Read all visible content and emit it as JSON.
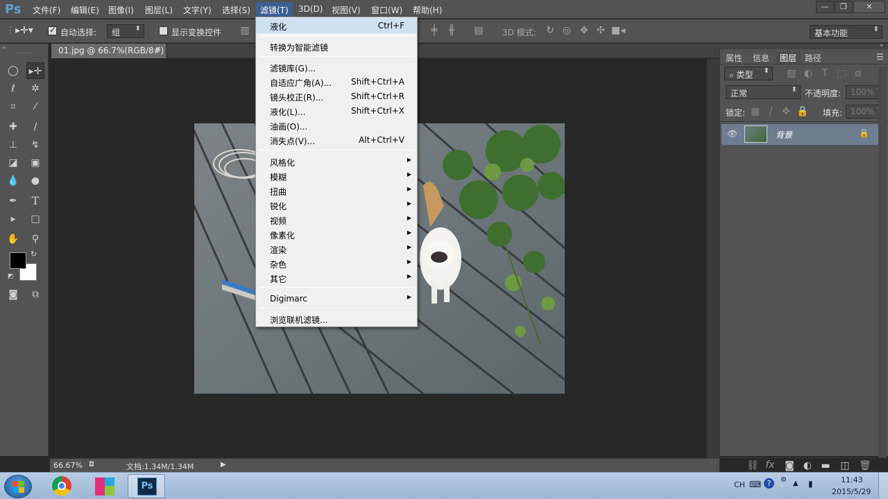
{
  "app": {
    "logo": "Ps"
  },
  "menubar": {
    "items": [
      "文件(F)",
      "编辑(E)",
      "图像(I)",
      "图层(L)",
      "文字(Y)",
      "选择(S)",
      "滤镜(T)",
      "3D(D)",
      "视图(V)",
      "窗口(W)",
      "帮助(H)"
    ],
    "window_controls": {
      "minimize": "—",
      "restore": "❐",
      "close": "✕"
    }
  },
  "options": {
    "auto_select_label": "自动选择:",
    "auto_select_value": "组",
    "show_transform_label": "显示变换控件",
    "mode3d_label": "3D 模式:",
    "workspace": "基本功能"
  },
  "document_tab": {
    "title": "01.jpg @ 66.7%(RGB/8#)",
    "close": "✕"
  },
  "panels": {
    "tabs": [
      "属性",
      "信息",
      "图层",
      "路径"
    ],
    "filter_kind": "类型",
    "blend_mode": "正常",
    "opacity_label": "不透明度:",
    "opacity_value": "100%",
    "lock_label": "锁定:",
    "fill_label": "填充:",
    "fill_value": "100%",
    "layer_name": "背景"
  },
  "status": {
    "zoom": "66.67%",
    "doc_info": "文档:1.34M/1.34M"
  },
  "filter_menu": {
    "items": [
      {
        "label": "液化",
        "shortcut": "Ctrl+F"
      },
      {
        "label": "转换为智能滤镜"
      },
      {
        "label": "滤镜库(G)..."
      },
      {
        "label": "自适应广角(A)...",
        "shortcut": "Shift+Ctrl+A"
      },
      {
        "label": "镜头校正(R)...",
        "shortcut": "Shift+Ctrl+R"
      },
      {
        "label": "液化(L)...",
        "shortcut": "Shift+Ctrl+X"
      },
      {
        "label": "油画(O)..."
      },
      {
        "label": "消失点(V)...",
        "shortcut": "Alt+Ctrl+V"
      },
      {
        "label": "风格化"
      },
      {
        "label": "模糊"
      },
      {
        "label": "扭曲"
      },
      {
        "label": "锐化"
      },
      {
        "label": "视频"
      },
      {
        "label": "像素化"
      },
      {
        "label": "渲染"
      },
      {
        "label": "杂色"
      },
      {
        "label": "其它"
      },
      {
        "label": "Digimarc"
      },
      {
        "label": "浏览联机滤镜..."
      }
    ]
  },
  "taskbar": {
    "tray_lang": "CH",
    "time": "11:43",
    "date": "2015/5/29",
    "ps_label": "Ps"
  },
  "colors": {
    "accent": "#3d5f8f",
    "menu_bg": "#f0f0f0",
    "panel_bg": "#535353"
  }
}
